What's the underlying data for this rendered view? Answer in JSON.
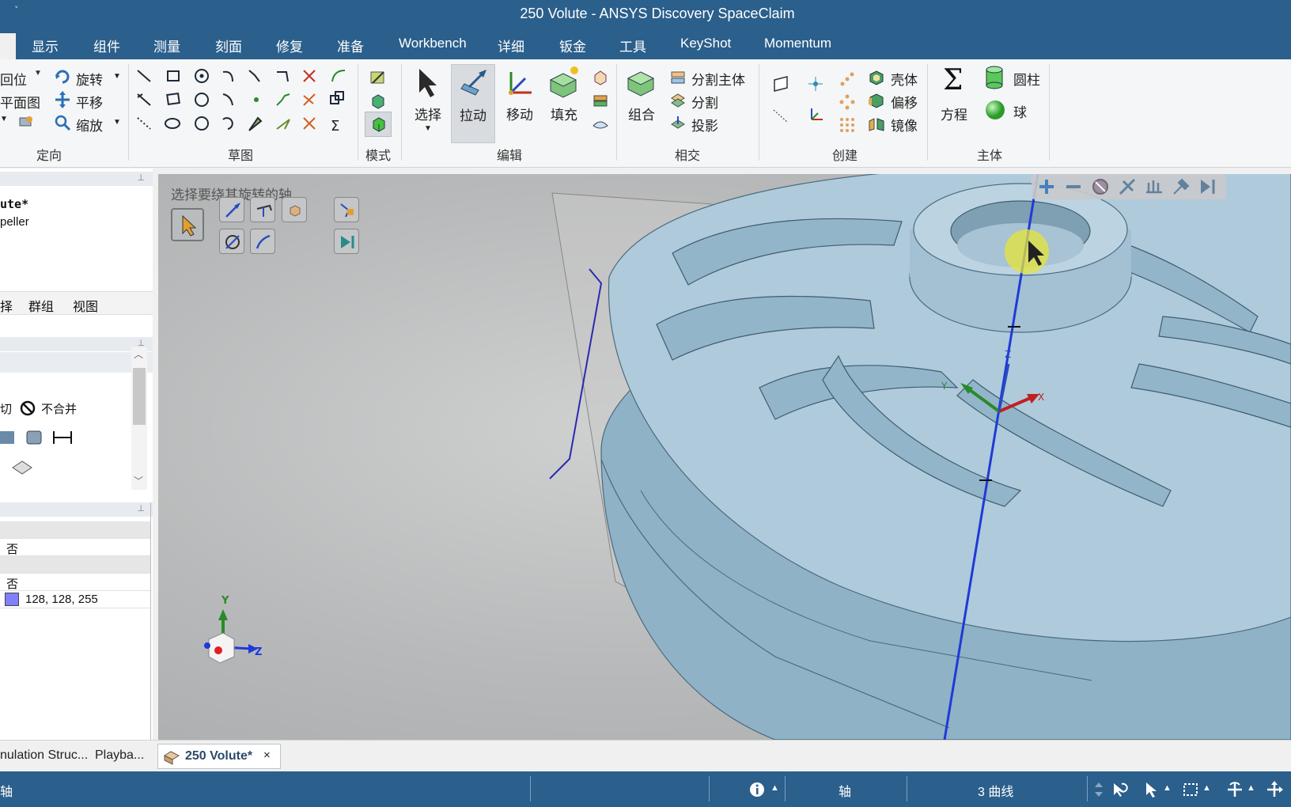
{
  "window": {
    "title": "250 Volute - ANSYS Discovery SpaceClaim",
    "qa_arrow": "˅"
  },
  "menu": {
    "tabs": [
      "显示",
      "组件",
      "测量",
      "刻面",
      "修复",
      "准备",
      "Workbench",
      "详细",
      "钣金",
      "工具",
      "KeyShot",
      "Momentum"
    ]
  },
  "ribbon": {
    "orient": {
      "label": "定向",
      "items": [
        "回位",
        "平面图",
        "旋转",
        "平移",
        "缩放"
      ]
    },
    "sketch": {
      "label": "草图"
    },
    "mode": {
      "label": "模式"
    },
    "edit": {
      "label": "编辑",
      "select": "选择",
      "pull": "拉动",
      "move": "移动",
      "fill": "填充"
    },
    "intersect": {
      "label": "相交",
      "combine": "组合",
      "split_body": "分割主体",
      "split": "分割",
      "project": "投影"
    },
    "create": {
      "label": "创建",
      "shell": "壳体",
      "offset": "偏移",
      "mirror": "镜像"
    },
    "body": {
      "label": "主体",
      "equation": "方程",
      "cylinder": "圆柱",
      "sphere": "球"
    }
  },
  "structure": {
    "root": "ute*",
    "child": "peller"
  },
  "left_tabs": [
    "择",
    "群组",
    "视图"
  ],
  "options": {
    "cut_partial": "切",
    "no_merge": "不合并"
  },
  "properties": {
    "row1": "否",
    "row2": "否",
    "color_value": "128, 128, 255",
    "color_swatch": "#8080ff"
  },
  "viewport": {
    "hint": "选择要绕其旋转的轴",
    "triad": {
      "y": "Y",
      "z": "Z"
    },
    "axis_labels": {
      "y": "Y",
      "z": "Z",
      "x": "X"
    }
  },
  "bottom_tabs": {
    "panel1": "nulation Struc...",
    "panel2": "Playba...",
    "doc": "250 Volute*",
    "close": "×"
  },
  "status": {
    "left": "轴",
    "mid": "轴",
    "selection": "3 曲线"
  },
  "colors": {
    "chrome_blue": "#2b5f8c",
    "model_blue": "#a9c4d4",
    "axis_blue": "#2233cc"
  }
}
